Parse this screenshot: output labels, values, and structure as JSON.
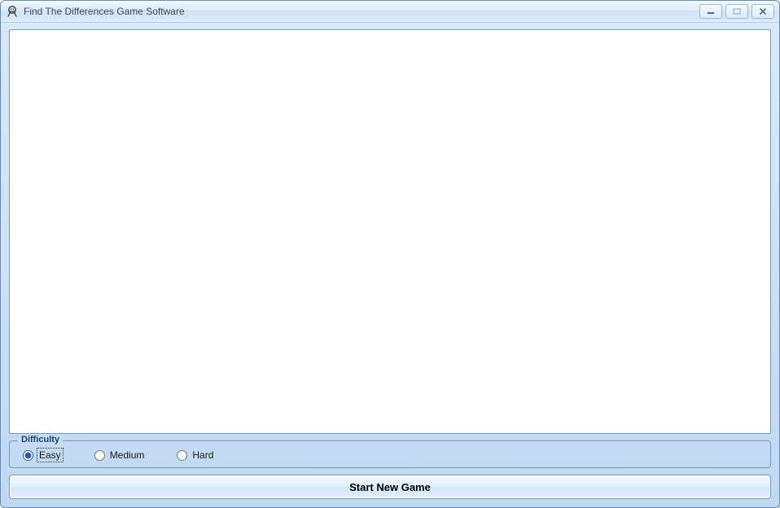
{
  "window": {
    "title": "Find The Differences Game Software"
  },
  "difficulty": {
    "legend": "Difficulty",
    "options": [
      "Easy",
      "Medium",
      "Hard"
    ],
    "selected": "Easy"
  },
  "buttons": {
    "start": "Start New Game"
  }
}
